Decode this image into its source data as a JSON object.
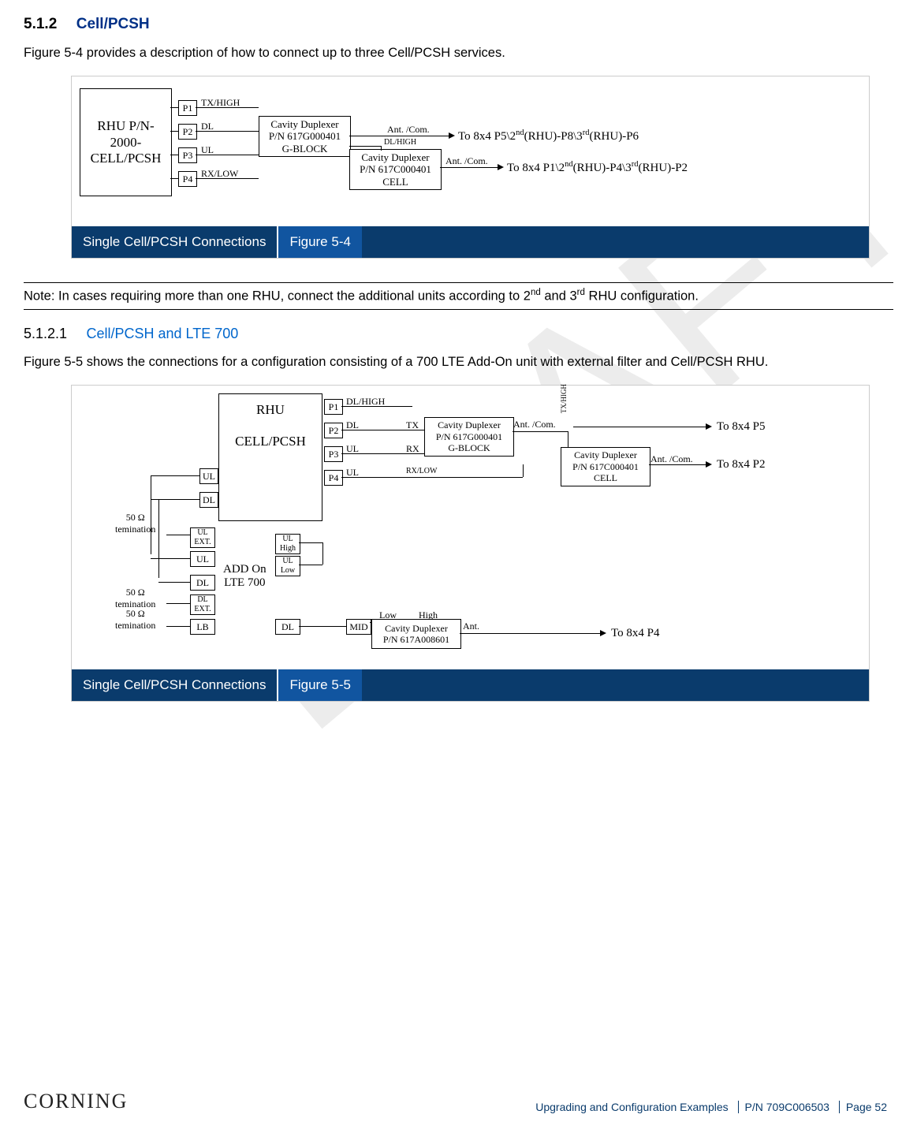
{
  "watermark": "DRAFT",
  "section512": {
    "num": "5.1.2",
    "title": "Cell/PCSH"
  },
  "intro512": "Figure 5-4 provides a description of how to connect up to three Cell/PCSH services.",
  "fig1": {
    "caption_left": "Single Cell/PCSH Connections",
    "caption_right": "Figure 5-4",
    "rhu_l1": "RHU P/N-",
    "rhu_l2": "2000-",
    "rhu_l3": "CELL/PCSH",
    "p1": "P1",
    "p2": "P2",
    "p3": "P3",
    "p4": "P4",
    "p1_lbl": "TX/HIGH",
    "p2_lbl": "DL",
    "p3_lbl": "UL",
    "p4_lbl": "RX/LOW",
    "dup1_l1": "Cavity Duplexer",
    "dup1_l2": "P/N 617G000401",
    "dup1_l3": "G-BLOCK",
    "dup2_l1": "Cavity Duplexer",
    "dup2_l2": "P/N 617C000401",
    "dup2_l3": "CELL",
    "ant1": "Ant. /Com.",
    "ant2": "Ant. /Com.",
    "dlhigh": "DL/HIGH",
    "out1_a": "To 8x4 P5\\2",
    "out1_b": "(RHU)-P8\\3",
    "out1_c": "(RHU)-P6",
    "out2_a": "To 8x4 P1\\2",
    "out2_b": "(RHU)-P4\\3",
    "out2_c": "(RHU)-P2",
    "nd": "nd",
    "rd": "rd"
  },
  "note": {
    "prefix": "Note: In cases requiring more than one RHU, connect the additional units according to 2",
    "mid": " and 3",
    "suffix": " RHU configuration.",
    "nd": "nd",
    "rd": "rd"
  },
  "section5121": {
    "num": "5.1.2.1",
    "title": "Cell/PCSH and LTE 700"
  },
  "intro5121": "Figure 5-5 shows the connections for a configuration consisting of a 700 LTE Add-On unit with external filter and Cell/PCSH RHU.",
  "fig2": {
    "caption_left": "Single Cell/PCSH Connections",
    "caption_right": "Figure 5-5",
    "rhu_l1": "RHU",
    "rhu_l2": "CELL/PCSH",
    "p1": "P1",
    "p2": "P2",
    "p3": "P3",
    "p4": "P4",
    "p1_lbl": "DL/HIGH",
    "p2_lbl": "DL",
    "p3_lbl": "UL",
    "p4_lbl": "UL",
    "tx": "TX",
    "rx": "RX",
    "rxlow": "RX/LOW",
    "ul": "UL",
    "dl": "DL",
    "ulext": "UL\nEXT.",
    "dlext": "DL\nEXT.",
    "lb": "LB",
    "addon_l1": "ADD On",
    "addon_l2": "LTE 700",
    "ulhigh": "UL\nHigh",
    "ullow": "UL\nLow",
    "dl2": "DL",
    "mid": "MID",
    "low": "Low",
    "high": "High",
    "term1": "50 Ω\ntemination",
    "term2": "50 Ω\ntemination",
    "term3": "50 Ω\ntemination",
    "dup1_l1": "Cavity Duplexer",
    "dup1_l2": "P/N 617G000401",
    "dup1_l3": "G-BLOCK",
    "dup2_l1": "Cavity Duplexer",
    "dup2_l2": "P/N 617C000401",
    "dup2_l3": "CELL",
    "dup3_l1": "Cavity Duplexer",
    "dup3_l2": "P/N 617A008601",
    "ant1": "Ant. /Com.",
    "ant2": "Ant. /Com.",
    "ant3": "Ant.",
    "txhigh": "TX/HIGH",
    "out1": "To 8x4 P5",
    "out2": "To 8x4 P2",
    "out3": "To 8x4 P4"
  },
  "footer": {
    "brand": "CORNING",
    "section": "Upgrading and Configuration Examples",
    "pn": "P/N 709C006503",
    "page": "Page 52"
  }
}
